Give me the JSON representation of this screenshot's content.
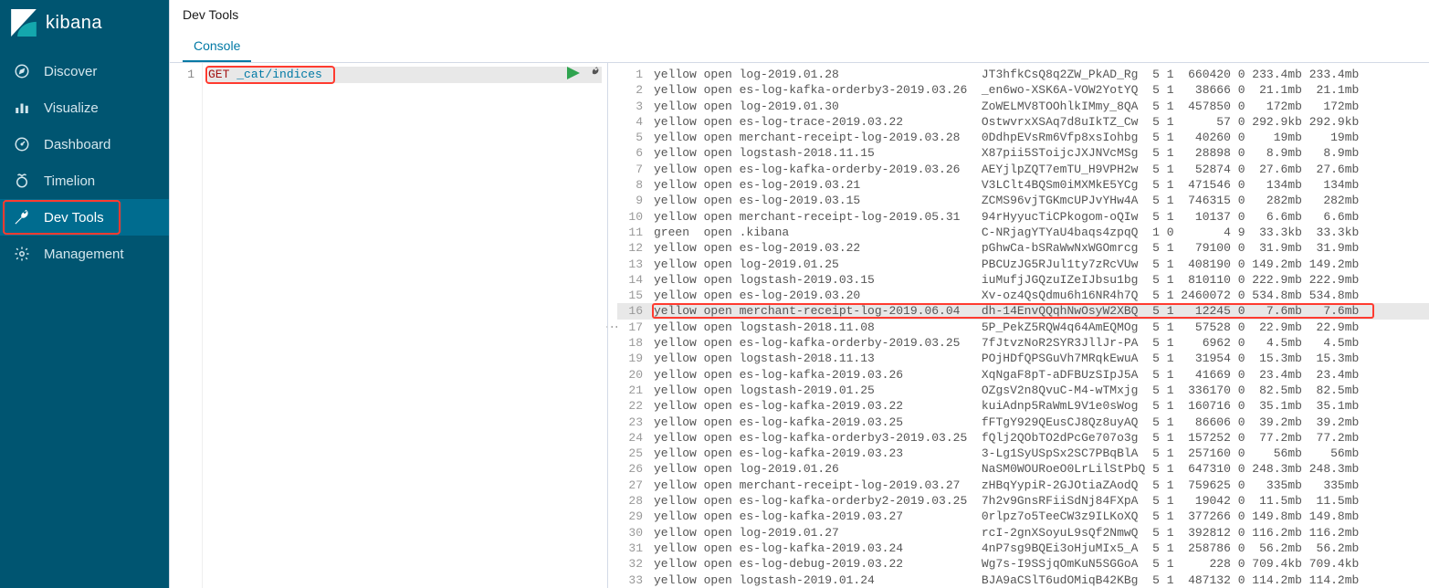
{
  "brand": {
    "name": "kibana"
  },
  "nav": {
    "items": [
      {
        "id": "discover",
        "label": "Discover"
      },
      {
        "id": "visualize",
        "label": "Visualize"
      },
      {
        "id": "dashboard",
        "label": "Dashboard"
      },
      {
        "id": "timelion",
        "label": "Timelion"
      },
      {
        "id": "devtools",
        "label": "Dev Tools"
      },
      {
        "id": "management",
        "label": "Management"
      }
    ],
    "active": "devtools"
  },
  "header": {
    "title": "Dev Tools",
    "tabs": [
      {
        "id": "console",
        "label": "Console"
      }
    ],
    "active_tab": "console"
  },
  "editor": {
    "lines": [
      {
        "n": 1,
        "method": "GET",
        "url": "_cat/indices"
      }
    ]
  },
  "output": {
    "highlight_line": 16,
    "rows": [
      {
        "n": 1,
        "health": "yellow",
        "status": "open",
        "index": "log-2019.01.28",
        "uuid": "JT3hfkCsQ8q2ZW_PkAD_Rg",
        "pri": 5,
        "rep": 1,
        "docs": 660420,
        "del": 0,
        "store": "233.4mb",
        "pri_store": "233.4mb"
      },
      {
        "n": 2,
        "health": "yellow",
        "status": "open",
        "index": "es-log-kafka-orderby3-2019.03.26",
        "uuid": "_en6wo-XSK6A-VOW2YotYQ",
        "pri": 5,
        "rep": 1,
        "docs": 38666,
        "del": 0,
        "store": "21.1mb",
        "pri_store": "21.1mb"
      },
      {
        "n": 3,
        "health": "yellow",
        "status": "open",
        "index": "log-2019.01.30",
        "uuid": "ZoWELMV8TOOhlkIMmy_8QA",
        "pri": 5,
        "rep": 1,
        "docs": 457850,
        "del": 0,
        "store": "172mb",
        "pri_store": "172mb"
      },
      {
        "n": 4,
        "health": "yellow",
        "status": "open",
        "index": "es-log-trace-2019.03.22",
        "uuid": "OstwvrxXSAq7d8uIkTZ_Cw",
        "pri": 5,
        "rep": 1,
        "docs": 57,
        "del": 0,
        "store": "292.9kb",
        "pri_store": "292.9kb"
      },
      {
        "n": 5,
        "health": "yellow",
        "status": "open",
        "index": "merchant-receipt-log-2019.03.28",
        "uuid": "0DdhpEVsRm6Vfp8xsIohbg",
        "pri": 5,
        "rep": 1,
        "docs": 40260,
        "del": 0,
        "store": "19mb",
        "pri_store": "19mb"
      },
      {
        "n": 6,
        "health": "yellow",
        "status": "open",
        "index": "logstash-2018.11.15",
        "uuid": "X87pii5SToijcJXJNVcMSg",
        "pri": 5,
        "rep": 1,
        "docs": 28898,
        "del": 0,
        "store": "8.9mb",
        "pri_store": "8.9mb"
      },
      {
        "n": 7,
        "health": "yellow",
        "status": "open",
        "index": "es-log-kafka-orderby-2019.03.26",
        "uuid": "AEYjlpZQT7emTU_H9VPH2w",
        "pri": 5,
        "rep": 1,
        "docs": 52874,
        "del": 0,
        "store": "27.6mb",
        "pri_store": "27.6mb"
      },
      {
        "n": 8,
        "health": "yellow",
        "status": "open",
        "index": "es-log-2019.03.21",
        "uuid": "V3LClt4BQSm0iMXMkE5YCg",
        "pri": 5,
        "rep": 1,
        "docs": 471546,
        "del": 0,
        "store": "134mb",
        "pri_store": "134mb"
      },
      {
        "n": 9,
        "health": "yellow",
        "status": "open",
        "index": "es-log-2019.03.15",
        "uuid": "ZCMS96vjTGKmcUPJvYHw4A",
        "pri": 5,
        "rep": 1,
        "docs": 746315,
        "del": 0,
        "store": "282mb",
        "pri_store": "282mb"
      },
      {
        "n": 10,
        "health": "yellow",
        "status": "open",
        "index": "merchant-receipt-log-2019.05.31",
        "uuid": "94rHyyucTiCPkogom-oQIw",
        "pri": 5,
        "rep": 1,
        "docs": 10137,
        "del": 0,
        "store": "6.6mb",
        "pri_store": "6.6mb"
      },
      {
        "n": 11,
        "health": "green",
        "status": "open",
        "index": ".kibana",
        "uuid": "C-NRjagYTYaU4baqs4zpqQ",
        "pri": 1,
        "rep": 0,
        "docs": 4,
        "del": 9,
        "store": "33.3kb",
        "pri_store": "33.3kb"
      },
      {
        "n": 12,
        "health": "yellow",
        "status": "open",
        "index": "es-log-2019.03.22",
        "uuid": "pGhwCa-bSRaWwNxWGOmrcg",
        "pri": 5,
        "rep": 1,
        "docs": 79100,
        "del": 0,
        "store": "31.9mb",
        "pri_store": "31.9mb"
      },
      {
        "n": 13,
        "health": "yellow",
        "status": "open",
        "index": "log-2019.01.25",
        "uuid": "PBCUzJG5RJul1ty7zRcVUw",
        "pri": 5,
        "rep": 1,
        "docs": 408190,
        "del": 0,
        "store": "149.2mb",
        "pri_store": "149.2mb"
      },
      {
        "n": 14,
        "health": "yellow",
        "status": "open",
        "index": "logstash-2019.03.15",
        "uuid": "iuMufjJGQzuIZeIJbsu1bg",
        "pri": 5,
        "rep": 1,
        "docs": 810110,
        "del": 0,
        "store": "222.9mb",
        "pri_store": "222.9mb"
      },
      {
        "n": 15,
        "health": "yellow",
        "status": "open",
        "index": "es-log-2019.03.20",
        "uuid": "Xv-oz4QsQdmu6h16NR4h7Q",
        "pri": 5,
        "rep": 1,
        "docs": 2460072,
        "del": 0,
        "store": "534.8mb",
        "pri_store": "534.8mb"
      },
      {
        "n": 16,
        "health": "yellow",
        "status": "open",
        "index": "merchant-receipt-log-2019.06.04",
        "uuid": "dh-14EnvQQqhNwOsyW2XBQ",
        "pri": 5,
        "rep": 1,
        "docs": 12245,
        "del": 0,
        "store": "7.6mb",
        "pri_store": "7.6mb"
      },
      {
        "n": 17,
        "health": "yellow",
        "status": "open",
        "index": "logstash-2018.11.08",
        "uuid": "5P_PekZ5RQW4q64AmEQMOg",
        "pri": 5,
        "rep": 1,
        "docs": 57528,
        "del": 0,
        "store": "22.9mb",
        "pri_store": "22.9mb"
      },
      {
        "n": 18,
        "health": "yellow",
        "status": "open",
        "index": "es-log-kafka-orderby-2019.03.25",
        "uuid": "7fJtvzNoR2SYR3JllJr-PA",
        "pri": 5,
        "rep": 1,
        "docs": 6962,
        "del": 0,
        "store": "4.5mb",
        "pri_store": "4.5mb"
      },
      {
        "n": 19,
        "health": "yellow",
        "status": "open",
        "index": "logstash-2018.11.13",
        "uuid": "POjHDfQPSGuVh7MRqkEwuA",
        "pri": 5,
        "rep": 1,
        "docs": 31954,
        "del": 0,
        "store": "15.3mb",
        "pri_store": "15.3mb"
      },
      {
        "n": 20,
        "health": "yellow",
        "status": "open",
        "index": "es-log-kafka-2019.03.26",
        "uuid": "XqNgaF8pT-aDFBUzSIpJ5A",
        "pri": 5,
        "rep": 1,
        "docs": 41669,
        "del": 0,
        "store": "23.4mb",
        "pri_store": "23.4mb"
      },
      {
        "n": 21,
        "health": "yellow",
        "status": "open",
        "index": "logstash-2019.01.25",
        "uuid": "OZgsV2n8QvuC-M4-wTMxjg",
        "pri": 5,
        "rep": 1,
        "docs": 336170,
        "del": 0,
        "store": "82.5mb",
        "pri_store": "82.5mb"
      },
      {
        "n": 22,
        "health": "yellow",
        "status": "open",
        "index": "es-log-kafka-2019.03.22",
        "uuid": "kuiAdnp5RaWmL9V1e0sWog",
        "pri": 5,
        "rep": 1,
        "docs": 160716,
        "del": 0,
        "store": "35.1mb",
        "pri_store": "35.1mb"
      },
      {
        "n": 23,
        "health": "yellow",
        "status": "open",
        "index": "es-log-kafka-2019.03.25",
        "uuid": "fFTgY929QEusCJ8Qz8uyAQ",
        "pri": 5,
        "rep": 1,
        "docs": 86606,
        "del": 0,
        "store": "39.2mb",
        "pri_store": "39.2mb"
      },
      {
        "n": 24,
        "health": "yellow",
        "status": "open",
        "index": "es-log-kafka-orderby3-2019.03.25",
        "uuid": "fQlj2QObTO2dPcGe707o3g",
        "pri": 5,
        "rep": 1,
        "docs": 157252,
        "del": 0,
        "store": "77.2mb",
        "pri_store": "77.2mb"
      },
      {
        "n": 25,
        "health": "yellow",
        "status": "open",
        "index": "es-log-kafka-2019.03.23",
        "uuid": "3-Lg1SyUSpSx2SC7PBqBlA",
        "pri": 5,
        "rep": 1,
        "docs": 257160,
        "del": 0,
        "store": "56mb",
        "pri_store": "56mb"
      },
      {
        "n": 26,
        "health": "yellow",
        "status": "open",
        "index": "log-2019.01.26",
        "uuid": "NaSM0WOURoeO0LrLilStPbQ",
        "pri": 5,
        "rep": 1,
        "docs": 647310,
        "del": 0,
        "store": "248.3mb",
        "pri_store": "248.3mb"
      },
      {
        "n": 27,
        "health": "yellow",
        "status": "open",
        "index": "merchant-receipt-log-2019.03.27",
        "uuid": "zHBqYypiR-2GJOtiaZAodQ",
        "pri": 5,
        "rep": 1,
        "docs": 759625,
        "del": 0,
        "store": "335mb",
        "pri_store": "335mb"
      },
      {
        "n": 28,
        "health": "yellow",
        "status": "open",
        "index": "es-log-kafka-orderby2-2019.03.25",
        "uuid": "7h2v9GnsRFiiSdNj84FXpA",
        "pri": 5,
        "rep": 1,
        "docs": 19042,
        "del": 0,
        "store": "11.5mb",
        "pri_store": "11.5mb"
      },
      {
        "n": 29,
        "health": "yellow",
        "status": "open",
        "index": "es-log-kafka-2019.03.27",
        "uuid": "0rlpz7o5TeeCW3z9ILKoXQ",
        "pri": 5,
        "rep": 1,
        "docs": 377266,
        "del": 0,
        "store": "149.8mb",
        "pri_store": "149.8mb"
      },
      {
        "n": 30,
        "health": "yellow",
        "status": "open",
        "index": "log-2019.01.27",
        "uuid": "rcI-2gnXSoyuL9sQf2NmwQ",
        "pri": 5,
        "rep": 1,
        "docs": 392812,
        "del": 0,
        "store": "116.2mb",
        "pri_store": "116.2mb"
      },
      {
        "n": 31,
        "health": "yellow",
        "status": "open",
        "index": "es-log-kafka-2019.03.24",
        "uuid": "4nP7sg9BQEi3oHjuMIx5_A",
        "pri": 5,
        "rep": 1,
        "docs": 258786,
        "del": 0,
        "store": "56.2mb",
        "pri_store": "56.2mb"
      },
      {
        "n": 32,
        "health": "yellow",
        "status": "open",
        "index": "es-log-debug-2019.03.22",
        "uuid": "Wg7s-I9SSjqOmKuN5SGGoA",
        "pri": 5,
        "rep": 1,
        "docs": 228,
        "del": 0,
        "store": "709.4kb",
        "pri_store": "709.4kb"
      },
      {
        "n": 33,
        "health": "yellow",
        "status": "open",
        "index": "logstash-2019.01.24",
        "uuid": "BJA9aCSlT6udOMiqB42KBg",
        "pri": 5,
        "rep": 1,
        "docs": 487132,
        "del": 0,
        "store": "114.2mb",
        "pri_store": "114.2mb"
      }
    ]
  }
}
